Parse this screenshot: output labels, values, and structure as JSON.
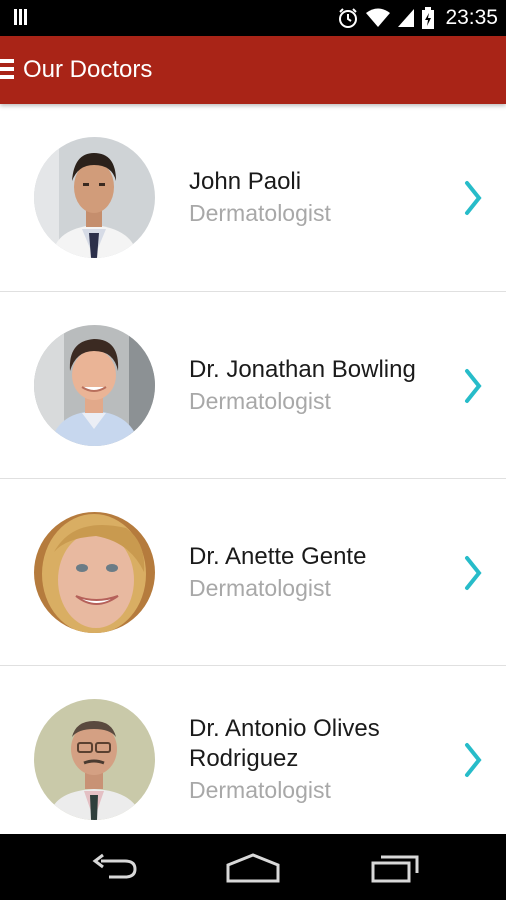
{
  "status_bar": {
    "time": "23:35"
  },
  "app_bar": {
    "title": "Our Doctors"
  },
  "doctors": [
    {
      "name": "John Paoli",
      "specialty": "Dermatologist"
    },
    {
      "name": "Dr. Jonathan Bowling",
      "specialty": "Dermatologist"
    },
    {
      "name": "Dr. Anette Gente",
      "specialty": "Dermatologist"
    },
    {
      "name": "Dr. Antonio Olives Rodriguez",
      "specialty": "Dermatologist"
    }
  ],
  "colors": {
    "app_bar": "#a92417",
    "chevron": "#27bcc9",
    "name": "#1a1a1a",
    "specialty": "#a8a8a8"
  },
  "icons": [
    "menu-icon",
    "chevron-right-icon",
    "back-icon",
    "home-icon",
    "recents-icon",
    "alarm-icon",
    "wifi-icon",
    "signal-icon",
    "battery-icon"
  ]
}
